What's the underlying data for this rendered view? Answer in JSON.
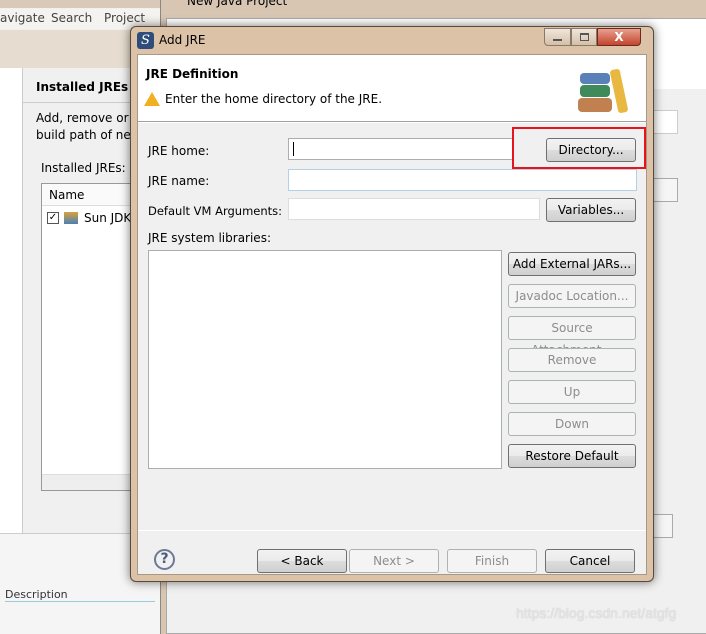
{
  "background_left": {
    "menu": [
      "avigate",
      "Search",
      "Project"
    ],
    "title": "Installed JREs",
    "desc_line1": "Add, remove or",
    "desc_line2": "build path of ne",
    "list_label": "Installed JREs:",
    "column": "Name",
    "row": "Sun JDK",
    "row_checked": true,
    "bottom": "Description"
  },
  "background_right": {
    "title": "New Java Project"
  },
  "dialog": {
    "title": "Add JRE",
    "header": {
      "title": "JRE Definition",
      "message": "Enter the home directory of the JRE.",
      "message_icon": "warning-icon"
    },
    "jre_home": {
      "label": "JRE home:",
      "value": ""
    },
    "jre_name": {
      "label": "JRE name:",
      "value": ""
    },
    "vm_args": {
      "label": "Default VM Arguments:",
      "value": ""
    },
    "libraries_label": "JRE system libraries:",
    "directory_button": "Directory...",
    "variables_button": "Variables...",
    "side_buttons": [
      {
        "label": "Add External JARs...",
        "enabled": true
      },
      {
        "label": "Javadoc Location...",
        "enabled": false
      },
      {
        "label": "Source Attachment...",
        "enabled": false
      },
      {
        "label": "Remove",
        "enabled": false
      },
      {
        "label": "Up",
        "enabled": false
      },
      {
        "label": "Down",
        "enabled": false
      },
      {
        "label": "Restore Default",
        "enabled": true
      }
    ],
    "footer": {
      "back": "< Back",
      "next": "Next >",
      "finish": "Finish",
      "cancel": "Cancel"
    },
    "highlight_color": "#e8141b"
  },
  "watermark": "https://blog.csdn.net/atgfg"
}
